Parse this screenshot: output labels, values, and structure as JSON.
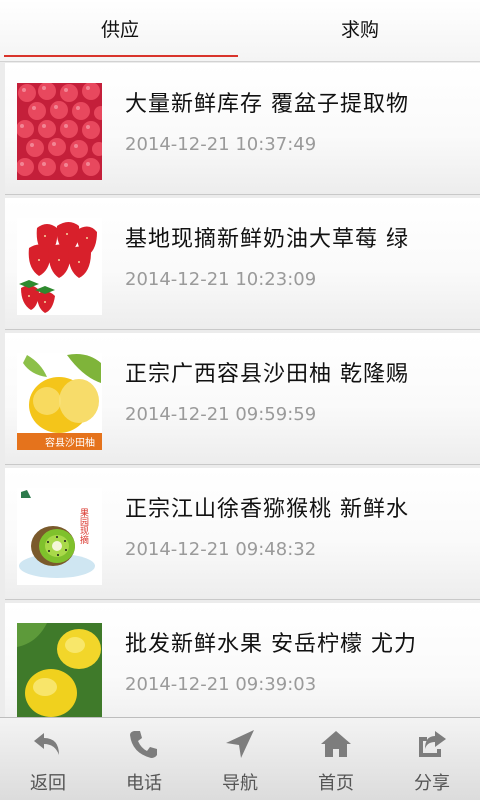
{
  "tabs": [
    {
      "label": "供应",
      "active": true
    },
    {
      "label": "求购",
      "active": false
    }
  ],
  "accent_color": "#d9342b",
  "items": [
    {
      "title": "大量新鲜库存 覆盆子提取物",
      "time": "2014-12-21 10:37:49",
      "image": "raspberries"
    },
    {
      "title": "基地现摘新鲜奶油大草莓 绿",
      "time": "2014-12-21 10:23:09",
      "image": "strawberries"
    },
    {
      "title": "正宗广西容县沙田柚 乾隆赐",
      "time": "2014-12-21 09:59:59",
      "image": "pomelo",
      "image_text": "容县沙田柚"
    },
    {
      "title": "正宗江山徐香猕猴桃 新鲜水",
      "time": "2014-12-21 09:48:32",
      "image": "kiwi",
      "image_text": "果园现摘"
    },
    {
      "title": "批发新鲜水果 安岳柠檬 尤力",
      "time": "2014-12-21 09:39:03",
      "image": "lemons"
    }
  ],
  "bottom_nav": [
    {
      "label": "返回",
      "icon": "back-arrow-icon"
    },
    {
      "label": "电话",
      "icon": "phone-icon"
    },
    {
      "label": "导航",
      "icon": "navigation-arrow-icon"
    },
    {
      "label": "首页",
      "icon": "home-icon"
    },
    {
      "label": "分享",
      "icon": "share-icon"
    }
  ]
}
